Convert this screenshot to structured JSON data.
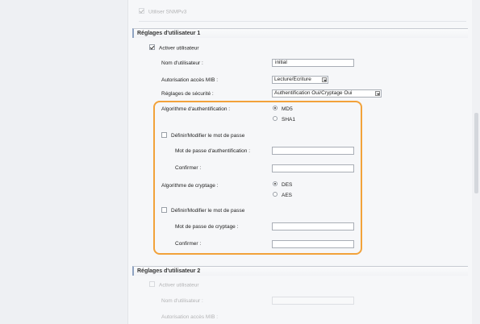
{
  "top_option": {
    "label": "Utiliser SNMPv3"
  },
  "user1": {
    "header": "Réglages d'utilisateur 1",
    "enable_label": "Activer utilisateur",
    "username_label": "Nom d'utilisateur :",
    "username_value": "initial",
    "mib_access_label": "Autorisation accès MIB :",
    "mib_access_value": "Lecture/Ecriture",
    "security_label": "Réglages de sécurité :",
    "security_value": "Authentification Oui/Cryptage Oui",
    "auth_algo_label": "Algorithme d'authentification :",
    "auth_algo_options": [
      "MD5",
      "SHA1"
    ],
    "auth_set_password_label": "Définir/Modifier le mot de passe",
    "auth_password_label": "Mot de passe d'authentification :",
    "auth_confirm_label": "Confirmer :",
    "enc_algo_label": "Algorithme de cryptage :",
    "enc_algo_options": [
      "DES",
      "AES"
    ],
    "enc_set_password_label": "Définir/Modifier le mot de passe",
    "enc_password_label": "Mot de passe de cryptage :",
    "enc_confirm_label": "Confirmer :"
  },
  "user2": {
    "header": "Réglages d'utilisateur 2",
    "enable_label": "Activer utilisateur",
    "username_label": "Nom d'utilisateur :",
    "mib_access_label": "Autorisation accès MIB :"
  },
  "colors": {
    "highlight": "#f2a23a",
    "header_accent": "#8fa3c2"
  }
}
